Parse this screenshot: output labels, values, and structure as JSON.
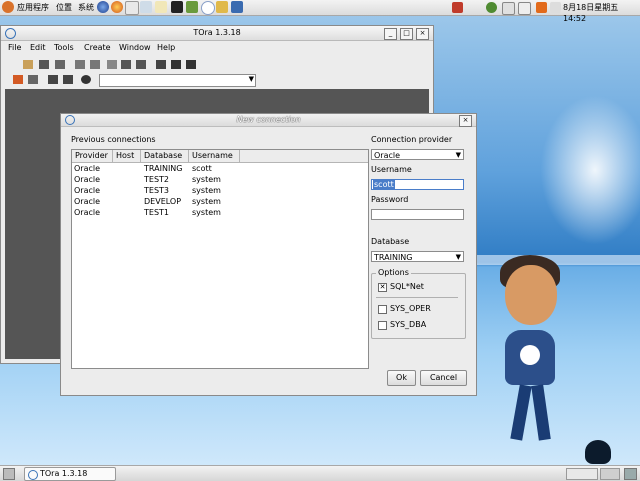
{
  "top_panel": {
    "menu_applications": "应用程序",
    "menu_places": "位置",
    "menu_system": "系统",
    "clock": "8月18日星期五 14:52"
  },
  "taskbar": {
    "task_label": "TOra 1.3.18"
  },
  "tora_window": {
    "title": "TOra 1.3.18",
    "menu": [
      "File",
      "Edit",
      "Tools",
      "Create",
      "Window",
      "Help"
    ]
  },
  "dialog": {
    "title": "New connection",
    "previous_connections_label": "Previous connections",
    "columns": [
      "Provider",
      "Host",
      "Database",
      "Username"
    ],
    "rows": [
      {
        "provider": "Oracle",
        "host": "",
        "database": "TRAINING",
        "username": "scott"
      },
      {
        "provider": "Oracle",
        "host": "",
        "database": "TEST2",
        "username": "system"
      },
      {
        "provider": "Oracle",
        "host": "",
        "database": "TEST3",
        "username": "system"
      },
      {
        "provider": "Oracle",
        "host": "",
        "database": "DEVELOP",
        "username": "system"
      },
      {
        "provider": "Oracle",
        "host": "",
        "database": "TEST1",
        "username": "system"
      }
    ],
    "connection_provider_label": "Connection provider",
    "connection_provider_value": "Oracle",
    "username_label": "Username",
    "username_value": "scott",
    "password_label": "Password",
    "password_value": "",
    "database_label": "Database",
    "database_value": "TRAINING",
    "options_label": "Options",
    "options": [
      {
        "label": "SQL*Net",
        "checked": true
      },
      {
        "label": "SYS_OPER",
        "checked": false
      },
      {
        "label": "SYS_DBA",
        "checked": false
      }
    ],
    "ok_label": "Ok",
    "cancel_label": "Cancel"
  }
}
